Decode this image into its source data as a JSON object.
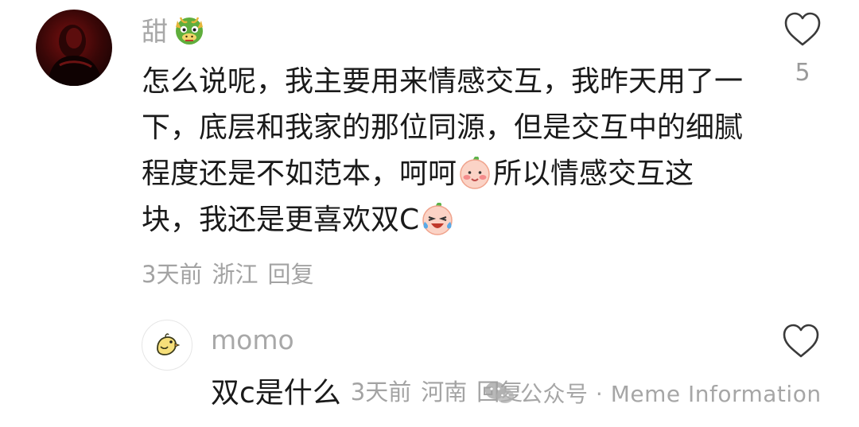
{
  "comment": {
    "username": "甜",
    "username_emoji": "dragon-emoji",
    "text_part1": "怎么说呢，我主要用来情感交互，我昨天用了一下，底层和我家的那位同源，但是交互中的细腻程度还是不如范本，呵呵",
    "text_part2": "所以情感交互这块，我还是更喜欢双C",
    "inline_emojis": [
      "shy-peach-emoji",
      "laughing-crying-peach-emoji"
    ],
    "time": "3天前",
    "location": "浙江",
    "reply_label": "回复",
    "like_count": "5"
  },
  "reply": {
    "username": "momo",
    "text": "双c是什么",
    "time": "3天前",
    "location": "河南",
    "reply_label": "回复"
  },
  "watermark": {
    "text": "公众号 · Meme Information"
  },
  "colors": {
    "primary_text": "#1a1a1a",
    "secondary_text": "#a3a3a3",
    "heart_stroke": "#3a3a3a"
  }
}
